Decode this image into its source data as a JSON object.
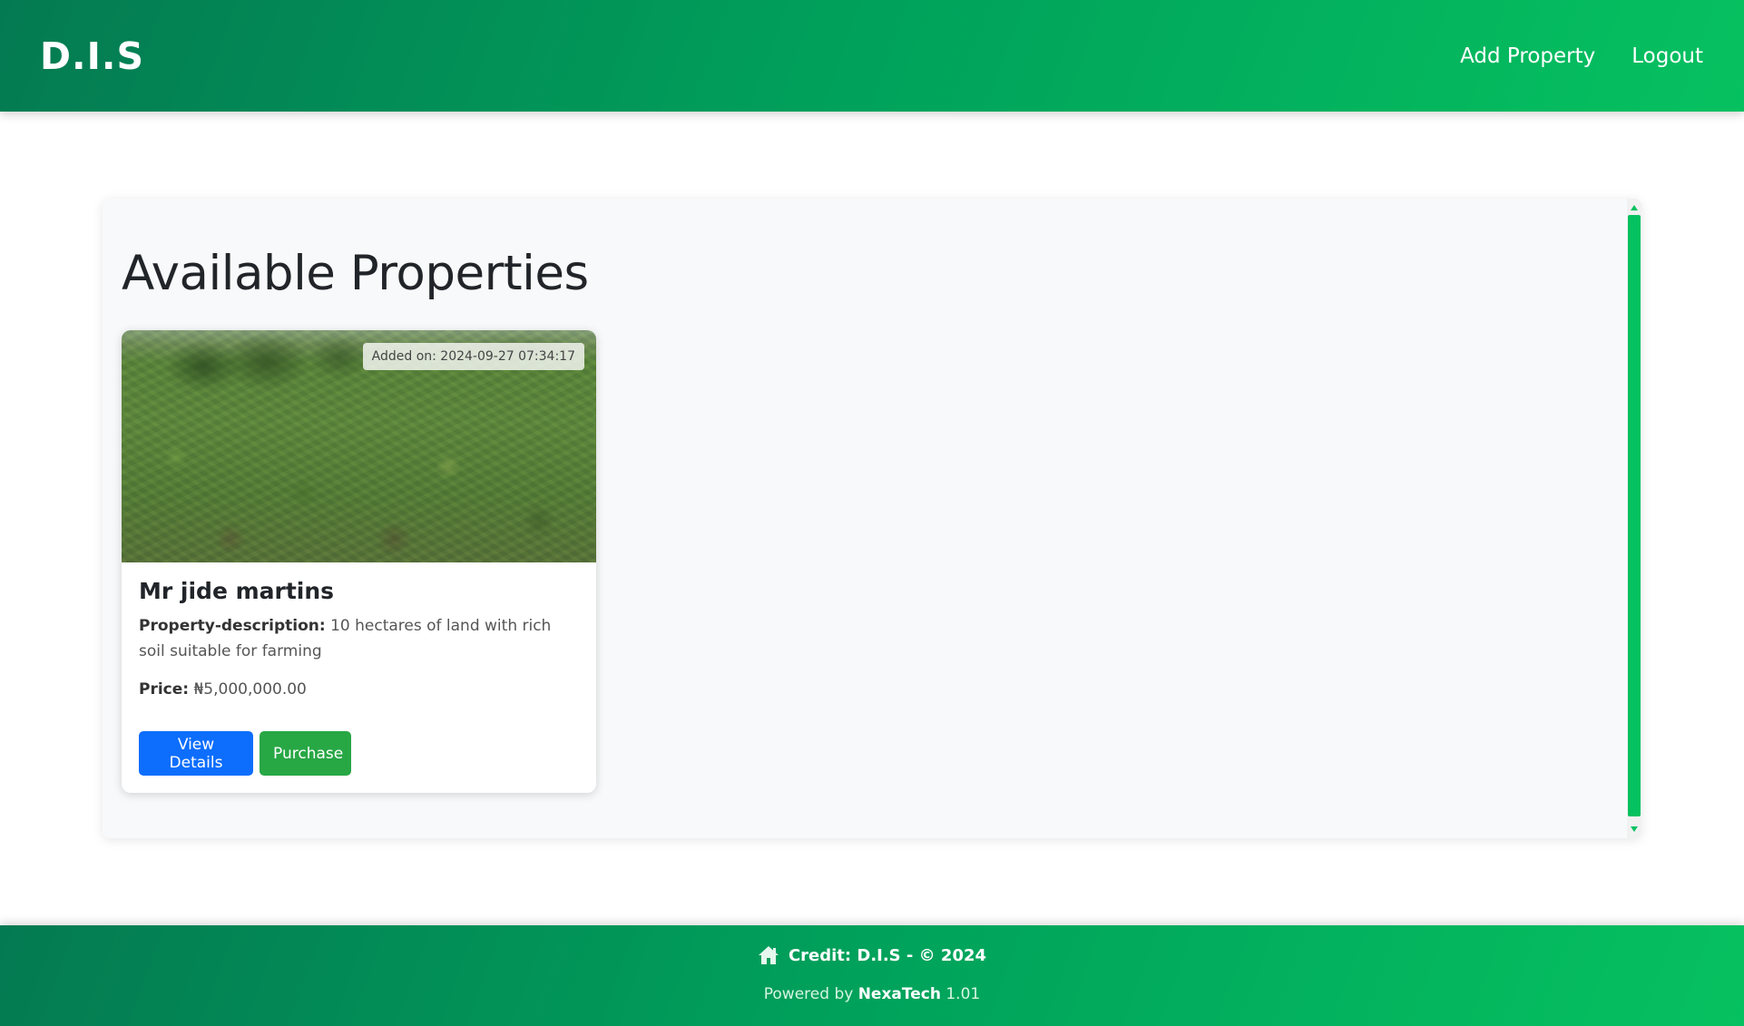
{
  "navbar": {
    "brand": "D.I.S",
    "links": [
      "Add Property",
      "Logout"
    ]
  },
  "main": {
    "title": "Available Properties",
    "properties": [
      {
        "added_label": "Added on: 2024-09-27 07:34:17",
        "owner": "Mr jide martins",
        "description_label": "Property-description:",
        "description": "10 hectares of land with rich soil suitable for farming",
        "price_label": "Price:",
        "price": "₦5,000,000.00",
        "buttons": {
          "details": "View Details",
          "purchase": "Purchase"
        }
      }
    ]
  },
  "footer": {
    "credit": "Credit: D.I.S - © 2024",
    "powered_prefix": "Powered by",
    "powered_brand": "NexaTech",
    "version": "1.01"
  },
  "colors": {
    "header_gradient_start": "#047a52",
    "header_gradient_end": "#06c160",
    "primary_button": "#0d6efd",
    "success_button": "#28a745",
    "scrollbar": "#06c160"
  },
  "icons": {
    "footer_icon": "home-icon"
  }
}
